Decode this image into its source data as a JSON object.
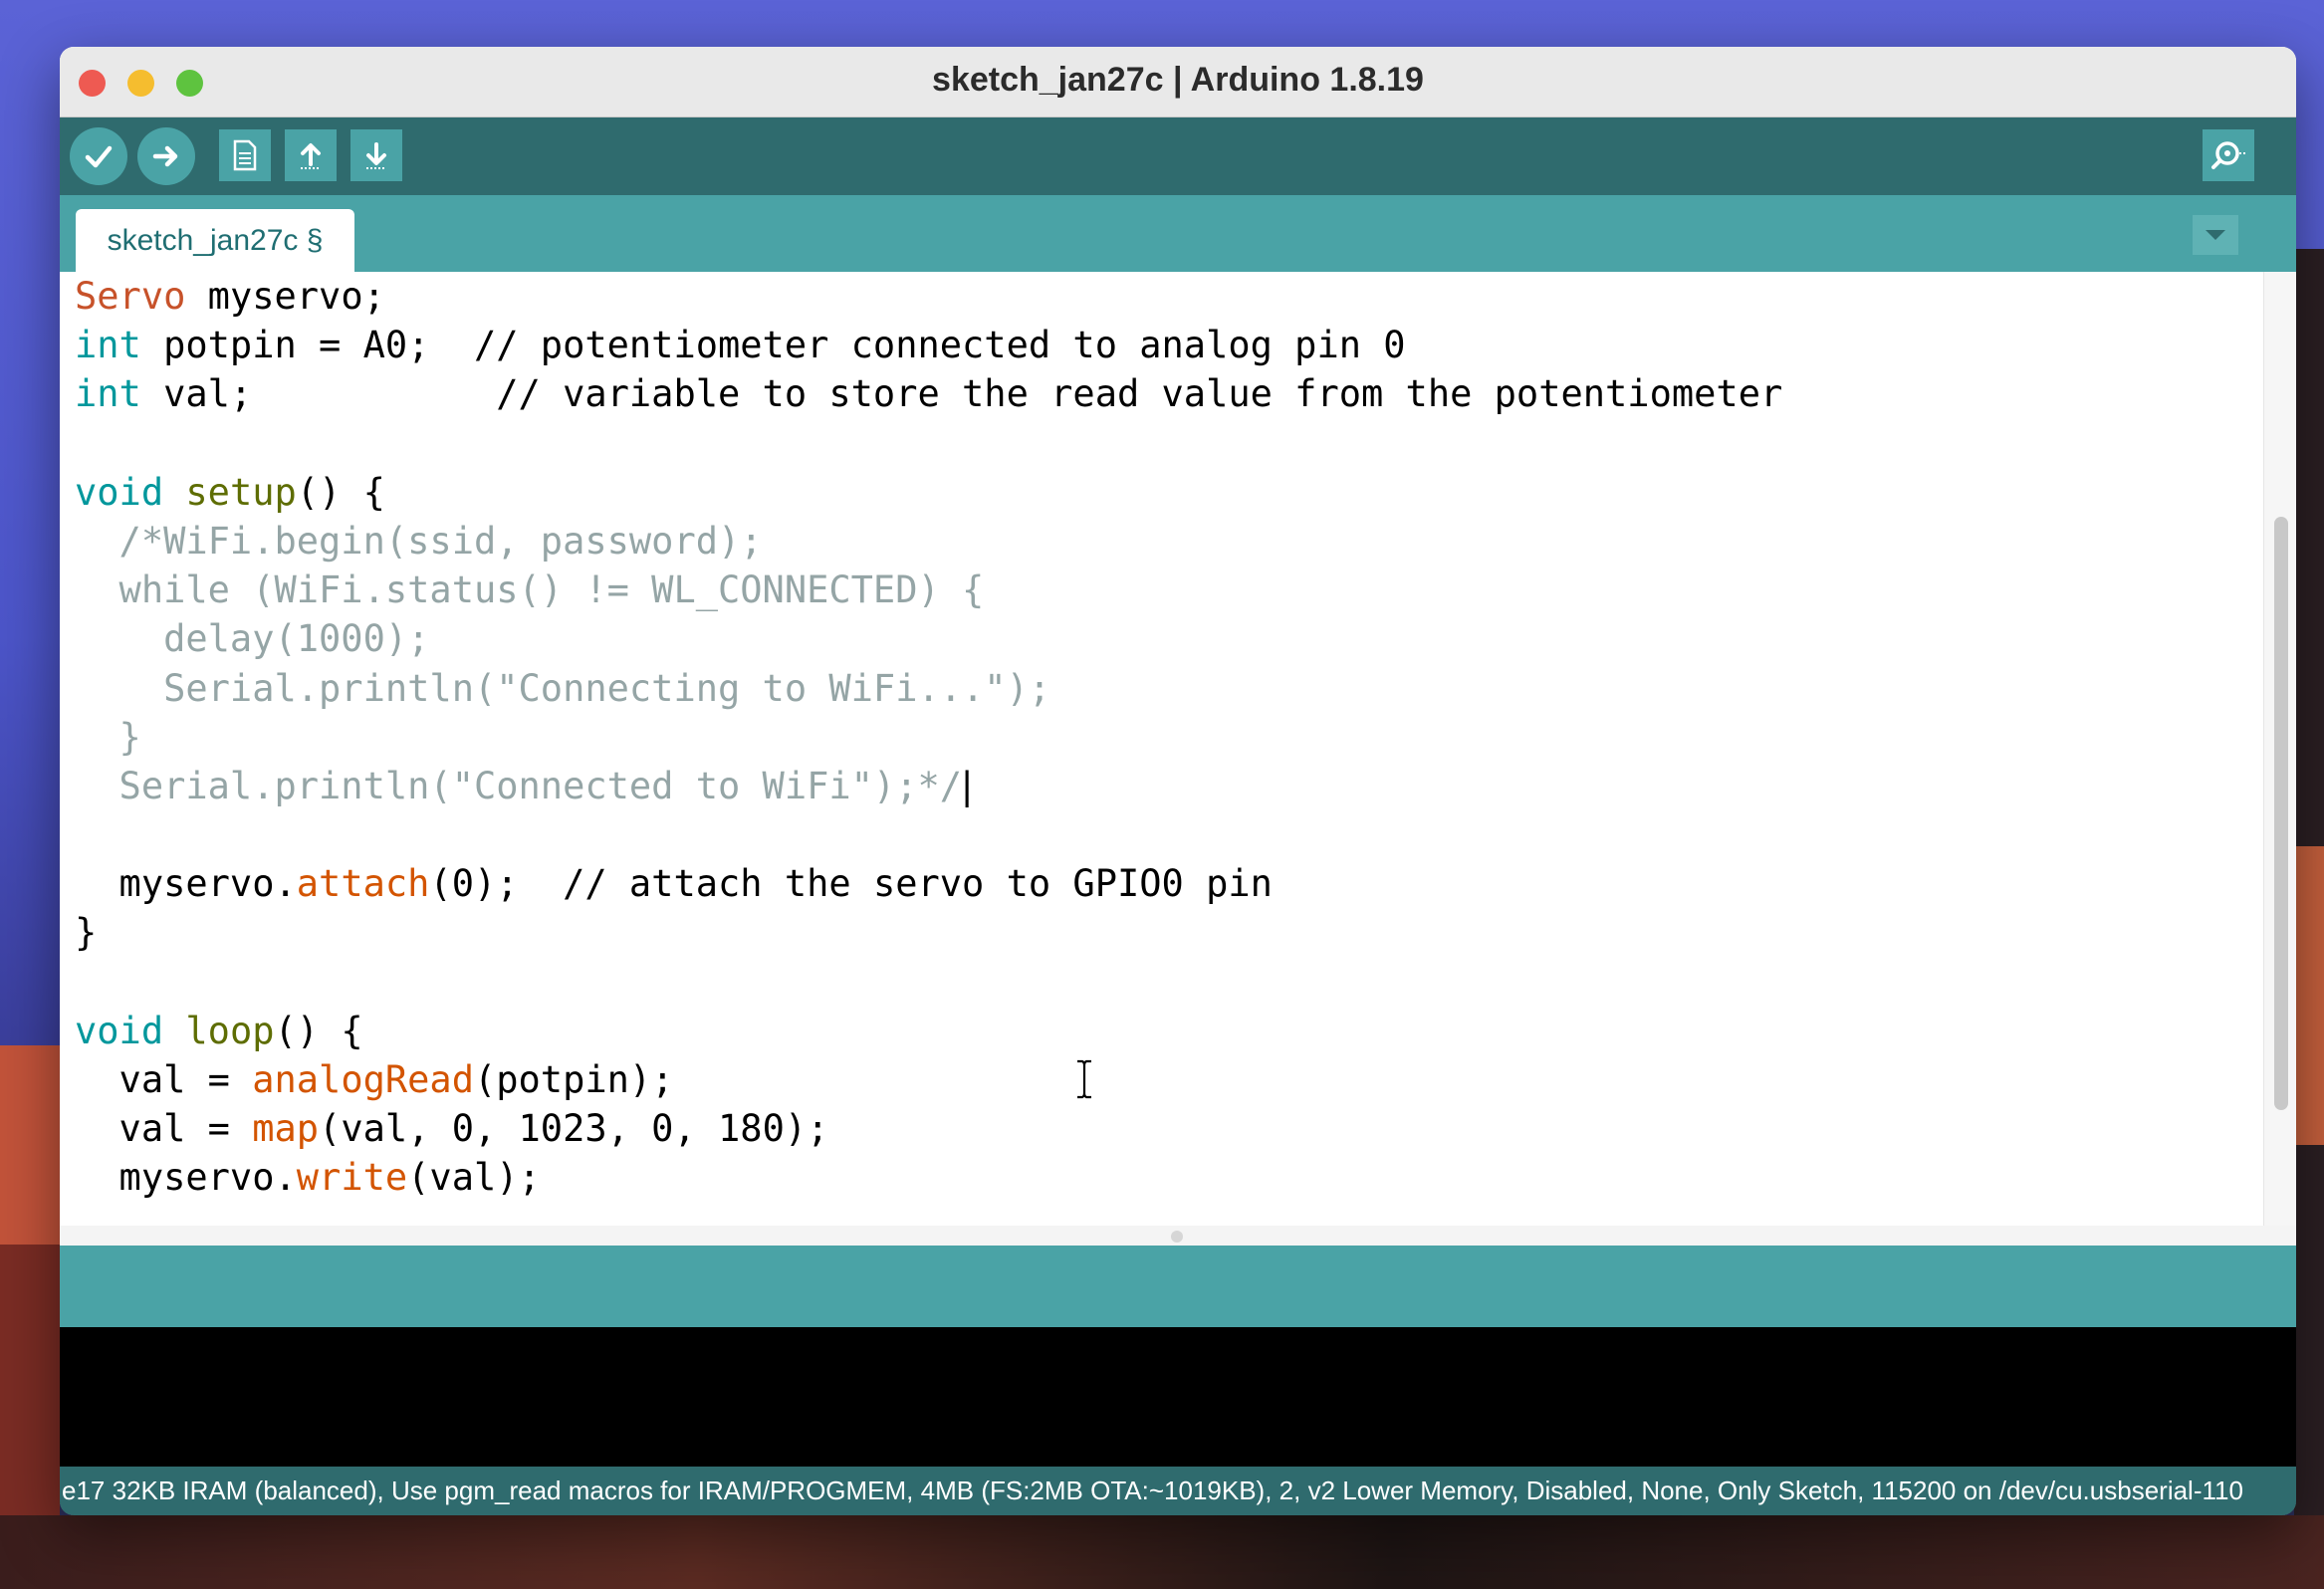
{
  "window": {
    "title": "sketch_jan27c | Arduino 1.8.19"
  },
  "toolbar": {
    "buttons": [
      {
        "name": "verify",
        "icon": "checkmark-icon"
      },
      {
        "name": "upload",
        "icon": "arrow-right-icon"
      },
      {
        "name": "new",
        "icon": "document-icon"
      },
      {
        "name": "open",
        "icon": "arrow-up-icon"
      },
      {
        "name": "save",
        "icon": "arrow-down-icon"
      },
      {
        "name": "serial-monitor",
        "icon": "magnifier-icon"
      }
    ]
  },
  "tabs": [
    {
      "label": "sketch_jan27c §",
      "active": true
    }
  ],
  "editor": {
    "lines": [
      {
        "segments": [
          {
            "t": "Servo",
            "c": "type"
          },
          {
            "t": " myservo;",
            "c": "plain"
          }
        ]
      },
      {
        "segments": [
          {
            "t": "int",
            "c": "kw"
          },
          {
            "t": " potpin = A0;  // potentiometer connected to analog pin 0",
            "c": "plain"
          }
        ]
      },
      {
        "segments": [
          {
            "t": "int",
            "c": "kw"
          },
          {
            "t": " val;           // variable to store the read value from the potentiometer",
            "c": "plain"
          }
        ]
      },
      {
        "segments": []
      },
      {
        "segments": [
          {
            "t": "void",
            "c": "kw"
          },
          {
            "t": " ",
            "c": "plain"
          },
          {
            "t": "setup",
            "c": "fn"
          },
          {
            "t": "() {",
            "c": "plain"
          }
        ]
      },
      {
        "segments": [
          {
            "t": "  /*WiFi.begin(ssid, password);",
            "c": "comment"
          }
        ]
      },
      {
        "segments": [
          {
            "t": "  while (WiFi.status() != WL_CONNECTED) {",
            "c": "comment"
          }
        ]
      },
      {
        "segments": [
          {
            "t": "    delay(1000);",
            "c": "comment"
          }
        ]
      },
      {
        "segments": [
          {
            "t": "    Serial.println(\"Connecting to WiFi...\");",
            "c": "comment"
          }
        ]
      },
      {
        "segments": [
          {
            "t": "  }",
            "c": "comment"
          }
        ]
      },
      {
        "segments": [
          {
            "t": "  Serial.println(\"Connected to WiFi\");*/",
            "c": "comment"
          },
          {
            "t": "|",
            "c": "caret"
          }
        ]
      },
      {
        "segments": []
      },
      {
        "segments": [
          {
            "t": "  myservo.",
            "c": "plain"
          },
          {
            "t": "attach",
            "c": "method"
          },
          {
            "t": "(0);  // attach the servo to GPIO0 pin",
            "c": "plain"
          }
        ]
      },
      {
        "segments": [
          {
            "t": "}",
            "c": "plain"
          }
        ]
      },
      {
        "segments": []
      },
      {
        "segments": [
          {
            "t": "void",
            "c": "kw"
          },
          {
            "t": " ",
            "c": "plain"
          },
          {
            "t": "loop",
            "c": "fn"
          },
          {
            "t": "() {",
            "c": "plain"
          }
        ]
      },
      {
        "segments": [
          {
            "t": "  val = ",
            "c": "plain"
          },
          {
            "t": "analogRead",
            "c": "method"
          },
          {
            "t": "(potpin);",
            "c": "plain"
          }
        ]
      },
      {
        "segments": [
          {
            "t": "  val = ",
            "c": "plain"
          },
          {
            "t": "map",
            "c": "method"
          },
          {
            "t": "(val, 0, 1023, 0, 180);",
            "c": "plain"
          }
        ]
      },
      {
        "segments": [
          {
            "t": "  myservo.",
            "c": "plain"
          },
          {
            "t": "write",
            "c": "method"
          },
          {
            "t": "(val);",
            "c": "plain"
          }
        ]
      }
    ],
    "colors": {
      "type": "#c7522a",
      "kw": "#00979c",
      "fn": "#5e6d03",
      "method": "#d35400",
      "plain": "#000000",
      "comment": "#95a5a6",
      "caret": "#000000"
    }
  },
  "footer": {
    "status_text": "e17 32KB IRAM (balanced), Use pgm_read macros for IRAM/PROGMEM, 4MB (FS:2MB OTA:~1019KB), 2, v2 Lower Memory, Disabled, None, Only Sketch, 115200 on /dev/cu.usbserial-110"
  }
}
